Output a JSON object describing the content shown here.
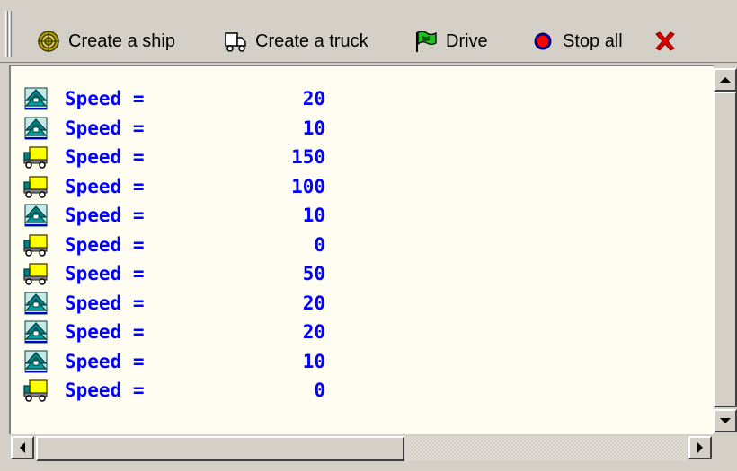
{
  "toolbar": {
    "buttons": [
      {
        "label": "Create a ship",
        "icon": "ship-target-icon"
      },
      {
        "label": "Create a truck",
        "icon": "truck-icon"
      },
      {
        "label": "Drive",
        "icon": "green-flag-icon"
      },
      {
        "label": "Stop all",
        "icon": "stop-dot-icon"
      },
      {
        "label": "",
        "icon": "close-x-icon"
      }
    ]
  },
  "vehicles": [
    {
      "type": "ship",
      "label": "Speed =",
      "speed": "20"
    },
    {
      "type": "ship",
      "label": "Speed =",
      "speed": "10"
    },
    {
      "type": "truck",
      "label": "Speed =",
      "speed": "150"
    },
    {
      "type": "truck",
      "label": "Speed =",
      "speed": "100"
    },
    {
      "type": "ship",
      "label": "Speed =",
      "speed": "10"
    },
    {
      "type": "truck",
      "label": "Speed =",
      "speed": "0"
    },
    {
      "type": "truck",
      "label": "Speed =",
      "speed": "50"
    },
    {
      "type": "ship",
      "label": "Speed =",
      "speed": "20"
    },
    {
      "type": "ship",
      "label": "Speed =",
      "speed": "20"
    },
    {
      "type": "ship",
      "label": "Speed =",
      "speed": "10"
    },
    {
      "type": "truck",
      "label": "Speed =",
      "speed": "0"
    }
  ],
  "colors": {
    "text": "#0000ff",
    "background": "#fffcf1",
    "chrome": "#d4d0c8"
  }
}
